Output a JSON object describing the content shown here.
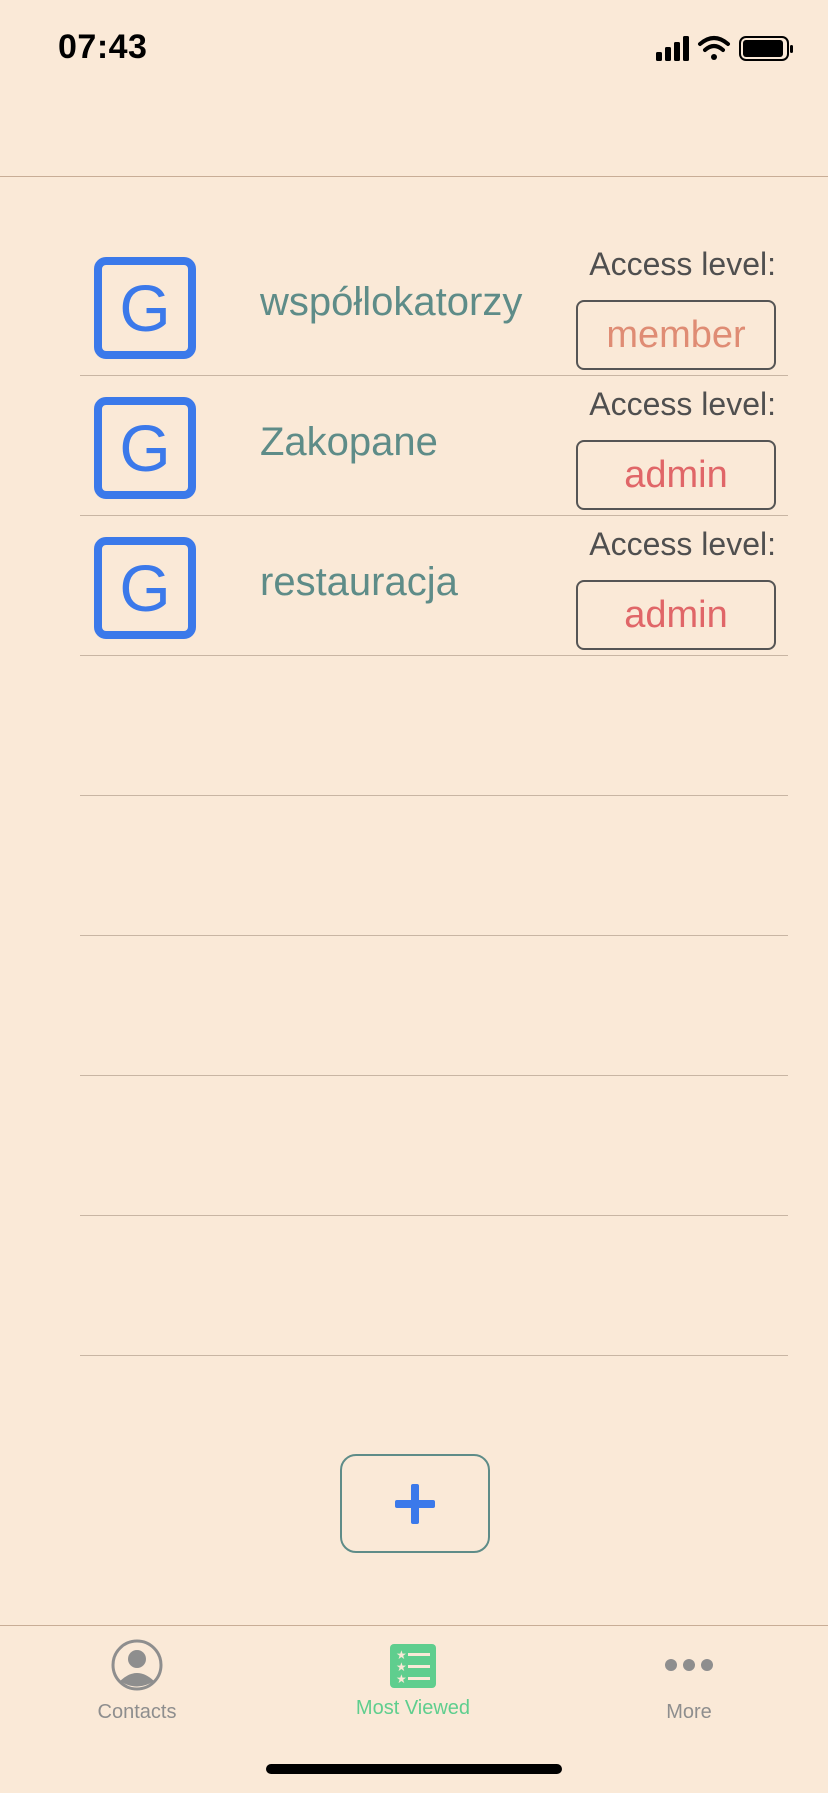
{
  "status_bar": {
    "time": "07:43"
  },
  "groups": [
    {
      "initial": "G",
      "name": "współlokatorzy",
      "access_label": "Access level:",
      "access": "member"
    },
    {
      "initial": "G",
      "name": "Zakopane",
      "access_label": "Access level:",
      "access": "admin"
    },
    {
      "initial": "G",
      "name": "restauracja",
      "access_label": "Access level:",
      "access": "admin"
    }
  ],
  "add_button": {
    "icon": "plus-icon"
  },
  "tab_bar": {
    "tabs": [
      {
        "label": "Contacts",
        "icon": "person-circle-icon"
      },
      {
        "label": "Most Viewed",
        "icon": "list-star-icon",
        "selected": true
      },
      {
        "label": "More",
        "icon": "ellipsis-icon"
      }
    ]
  },
  "colors": {
    "background": "#fae9d7",
    "group_icon": "#3b79ea",
    "group_name": "#5e8c88",
    "member": "#df8c74",
    "admin": "#e06668",
    "tab_selected": "#5fce8e",
    "tab_unselected": "#8e8e8e"
  }
}
